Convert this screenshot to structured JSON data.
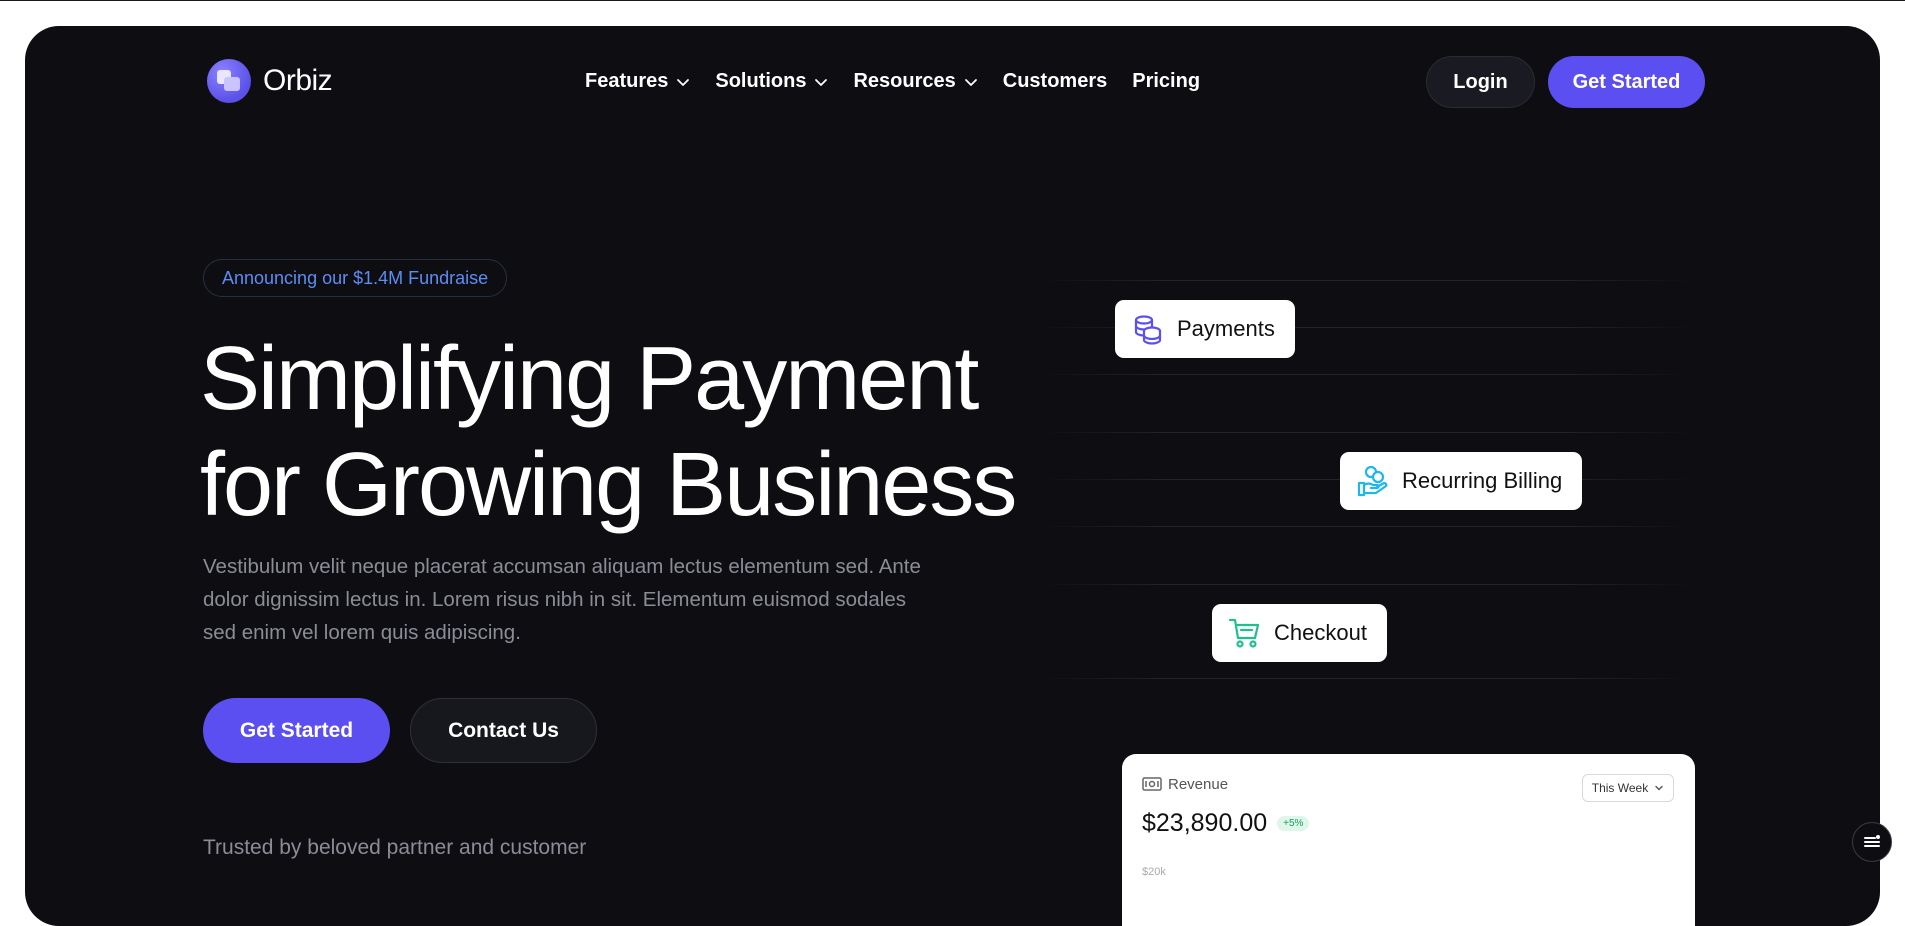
{
  "brand": {
    "name": "Orbiz"
  },
  "nav": {
    "items": [
      {
        "label": "Features",
        "dropdown": true
      },
      {
        "label": "Solutions",
        "dropdown": true
      },
      {
        "label": "Resources",
        "dropdown": true
      },
      {
        "label": "Customers",
        "dropdown": false
      },
      {
        "label": "Pricing",
        "dropdown": false
      }
    ]
  },
  "header": {
    "login_label": "Login",
    "get_started_label": "Get Started"
  },
  "hero": {
    "badge": "Announcing our $1.4M Fundraise",
    "title_line1": "Simplifying Payment",
    "title_line2": "for Growing Business",
    "subtitle": "Vestibulum velit neque placerat accumsan aliquam lectus elementum sed. Ante dolor dignissim lectus in. Lorem risus nibh in sit. Elementum euismod sodales sed enim vel lorem quis adipiscing.",
    "primary_cta": "Get Started",
    "secondary_cta": "Contact Us",
    "trusted_text": "Trusted by beloved partner and customer"
  },
  "features": [
    {
      "label": "Payments",
      "icon": "coins-stack-icon",
      "color": "#5b4ff2"
    },
    {
      "label": "Recurring Billing",
      "icon": "hand-coin-icon",
      "color": "#1fb6e8"
    },
    {
      "label": "Checkout",
      "icon": "cart-icon",
      "color": "#1fbf8f"
    }
  ],
  "revenue_card": {
    "title": "Revenue",
    "amount": "$23,890.00",
    "change": "+5%",
    "period": "This Week",
    "y_tick_top": "$20k"
  },
  "colors": {
    "accent": "#5b4ff2",
    "background": "#0e0e12",
    "badge_text": "#5c8cf5"
  }
}
